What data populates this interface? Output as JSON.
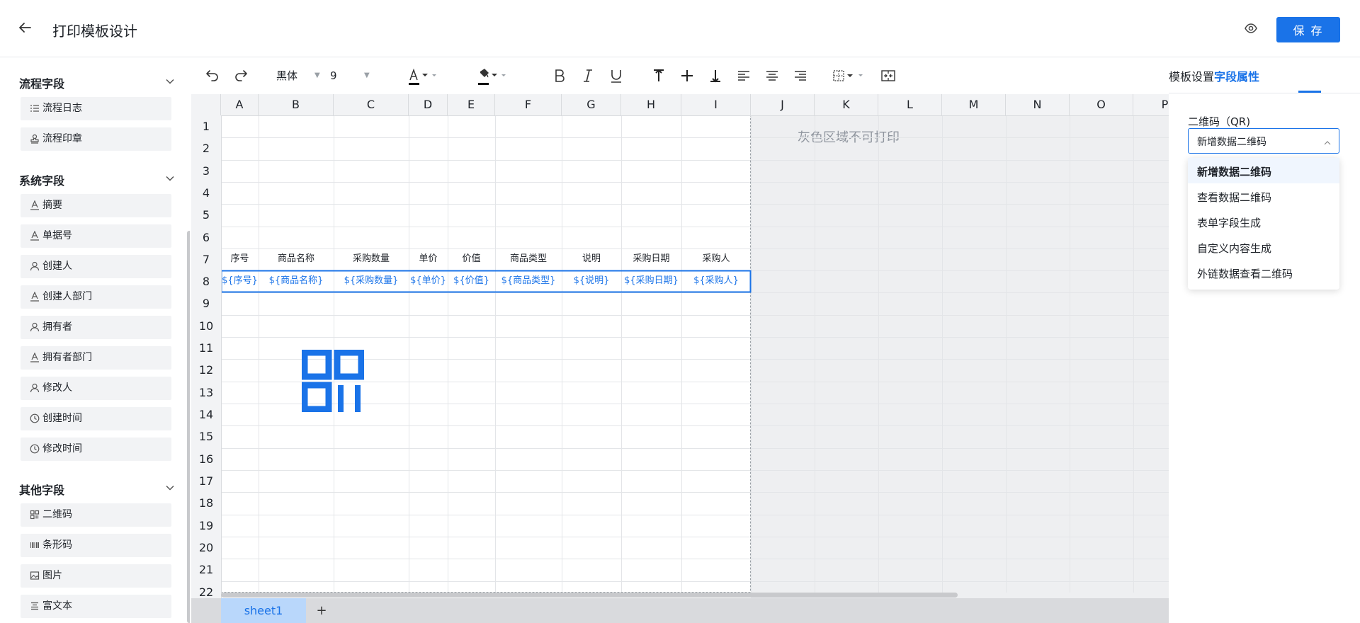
{
  "header": {
    "title": "打印模板设计",
    "save_label": "保 存"
  },
  "sidebar": {
    "groups": [
      {
        "title": "流程字段",
        "items": [
          {
            "label": "流程日志",
            "icon": "list-icon"
          },
          {
            "label": "流程印章",
            "icon": "stamp-icon"
          }
        ]
      },
      {
        "title": "系统字段",
        "items": [
          {
            "label": "摘要",
            "icon": "text-a-icon"
          },
          {
            "label": "单据号",
            "icon": "text-a-icon"
          },
          {
            "label": "创建人",
            "icon": "user-icon"
          },
          {
            "label": "创建人部门",
            "icon": "text-a-icon"
          },
          {
            "label": "拥有者",
            "icon": "user-icon"
          },
          {
            "label": "拥有者部门",
            "icon": "text-a-icon"
          },
          {
            "label": "修改人",
            "icon": "user-icon"
          },
          {
            "label": "创建时间",
            "icon": "clock-icon"
          },
          {
            "label": "修改时间",
            "icon": "clock-icon"
          }
        ]
      },
      {
        "title": "其他字段",
        "items": [
          {
            "label": "二维码",
            "icon": "qrcode-icon"
          },
          {
            "label": "条形码",
            "icon": "barcode-icon"
          },
          {
            "label": "图片",
            "icon": "image-icon"
          },
          {
            "label": "富文本",
            "icon": "richtext-icon"
          }
        ]
      }
    ]
  },
  "toolbar": {
    "font_family": "黑体",
    "font_size": "9"
  },
  "sheet": {
    "columns": [
      "A",
      "B",
      "C",
      "D",
      "E",
      "F",
      "G",
      "H",
      "I",
      "J",
      "K",
      "L",
      "M",
      "N",
      "O",
      "P"
    ],
    "rows": [
      "1",
      "2",
      "3",
      "4",
      "5",
      "6",
      "7",
      "8",
      "9",
      "10",
      "11",
      "12",
      "13",
      "14",
      "15",
      "16",
      "17",
      "18",
      "19",
      "20",
      "21",
      "22"
    ],
    "header_row": [
      "序号",
      "商品名称",
      "采购数量",
      "单价",
      "价值",
      "商品类型",
      "说明",
      "采购日期",
      "采购人"
    ],
    "variable_row": [
      "${序号}",
      "${商品名称}",
      "${采购数量}",
      "${单价}",
      "${价值}",
      "${商品类型}",
      "${说明}",
      "${采购日期}",
      "${采购人}"
    ],
    "gray_note": "灰色区域不可打印",
    "tab": "sheet1",
    "add_tab": "+"
  },
  "right_panel": {
    "tab_template": "模板设置",
    "tab_field": "字段属性",
    "qr_label": "二维码（QR)",
    "qr_value": "新增数据二维码",
    "options": [
      "新增数据二维码",
      "查看数据二维码",
      "表单字段生成",
      "自定义内容生成",
      "外链数据查看二维码"
    ],
    "selected_option": "新增数据二维码"
  },
  "colors": {
    "accent": "#1a73e8",
    "gray_area": "#eeeff1",
    "header_bg": "#f2f3f5"
  }
}
